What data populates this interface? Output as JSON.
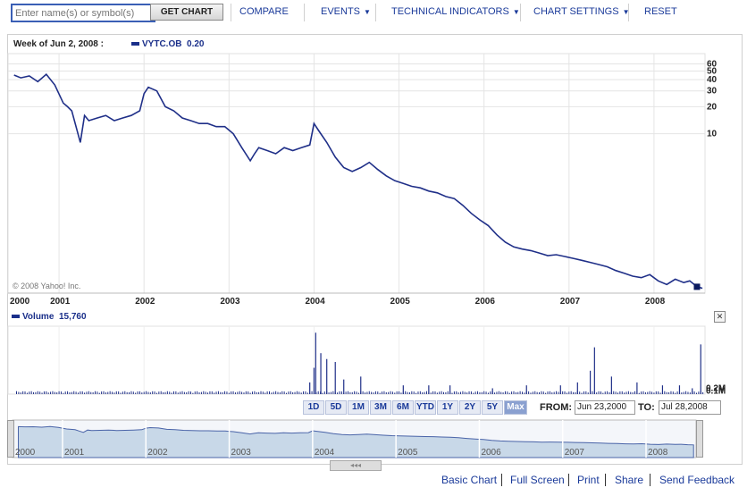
{
  "toolbar": {
    "symbol_placeholder": "Enter name(s) or symbol(s)",
    "get_chart": "GET CHART",
    "compare": "COMPARE",
    "events": "EVENTS",
    "technical_indicators": "TECHNICAL INDICATORS",
    "chart_settings": "CHART SETTINGS",
    "reset": "RESET"
  },
  "header": {
    "week_label": "Week of Jun 2, 2008 :",
    "ticker": "VYTC.OB",
    "ticker_value": "0.20"
  },
  "copyright": "© 2008 Yahoo! Inc.",
  "volume_header": {
    "label": "Volume",
    "value": "15,760"
  },
  "range_buttons": [
    "1D",
    "5D",
    "1M",
    "3M",
    "6M",
    "YTD",
    "1Y",
    "2Y",
    "5Y",
    "Max"
  ],
  "active_range": "Max",
  "from_label": "FROM:",
  "from_value": "Jun 23,2000",
  "to_label": "TO:",
  "to_value": "Jul 28,2008",
  "footer": {
    "basic_chart": "Basic Chart",
    "full_screen": "Full Screen",
    "print": "Print",
    "share": "Share",
    "send_feedback": "Send Feedback"
  },
  "colors": {
    "line": "#1f2f88",
    "accent": "#1a3a9a",
    "overview_fill": "#c8d8e8"
  },
  "chart_data": [
    {
      "type": "line",
      "scale": "log",
      "series": [
        {
          "name": "VYTC.OB",
          "x": [
            2000.47,
            2000.55,
            2000.65,
            2000.75,
            2000.85,
            2000.95,
            2001.05,
            2001.1,
            2001.15,
            2001.2,
            2001.25,
            2001.3,
            2001.35,
            2001.45,
            2001.55,
            2001.65,
            2001.75,
            2001.85,
            2001.95,
            2002.0,
            2002.05,
            2002.15,
            2002.25,
            2002.35,
            2002.45,
            2002.55,
            2002.65,
            2002.75,
            2002.85,
            2002.95,
            2003.05,
            2003.15,
            2003.25,
            2003.3,
            2003.35,
            2003.45,
            2003.55,
            2003.65,
            2003.75,
            2003.85,
            2003.95,
            2004.0,
            2004.05,
            2004.15,
            2004.25,
            2004.35,
            2004.45,
            2004.55,
            2004.65,
            2004.75,
            2004.85,
            2004.95,
            2005.05,
            2005.15,
            2005.25,
            2005.35,
            2005.45,
            2005.55,
            2005.65,
            2005.75,
            2005.85,
            2005.95,
            2006.05,
            2006.15,
            2006.25,
            2006.35,
            2006.45,
            2006.55,
            2006.65,
            2006.75,
            2006.85,
            2006.95,
            2007.05,
            2007.15,
            2007.25,
            2007.35,
            2007.45,
            2007.55,
            2007.65,
            2007.75,
            2007.85,
            2007.95,
            2008.05,
            2008.15,
            2008.25,
            2008.35,
            2008.42,
            2008.5,
            2008.57
          ],
          "y": [
            45,
            42,
            44,
            38,
            46,
            35,
            22,
            20,
            18,
            12,
            8,
            16,
            14,
            15,
            16,
            14,
            15,
            16,
            18,
            28,
            33,
            30,
            20,
            18,
            15,
            14,
            13,
            13,
            12,
            12,
            10,
            7,
            5,
            6,
            7,
            6.5,
            6,
            7,
            6.5,
            7,
            7.5,
            13,
            11,
            8,
            5.5,
            4.2,
            3.8,
            4.2,
            4.8,
            4.0,
            3.4,
            3.0,
            2.8,
            2.6,
            2.5,
            2.3,
            2.2,
            2.0,
            1.9,
            1.6,
            1.3,
            1.1,
            0.95,
            0.75,
            0.62,
            0.55,
            0.52,
            0.5,
            0.47,
            0.44,
            0.45,
            0.43,
            0.41,
            0.39,
            0.37,
            0.35,
            0.33,
            0.3,
            0.28,
            0.26,
            0.25,
            0.27,
            0.23,
            0.21,
            0.24,
            0.22,
            0.23,
            0.2,
            0.19
          ]
        }
      ],
      "x_ticks": [
        "2000",
        "2001",
        "2002",
        "2003",
        "2004",
        "2005",
        "2006",
        "2007",
        "2008"
      ],
      "y_ticks": [
        "60",
        "50",
        "40",
        "30",
        "20",
        "10"
      ],
      "xlim": [
        2000.4,
        2008.6
      ],
      "ylim": [
        0.18,
        65
      ],
      "grid": true
    },
    {
      "type": "bar",
      "series": [
        {
          "name": "Volume",
          "x": [
            2003.95,
            2004.0,
            2004.02,
            2004.08,
            2004.15,
            2004.25,
            2004.35,
            2004.55,
            2005.05,
            2005.35,
            2005.6,
            2006.1,
            2006.5,
            2006.9,
            2007.1,
            2007.25,
            2007.3,
            2007.5,
            2007.8,
            2008.1,
            2008.3,
            2008.45,
            2008.55
          ],
          "values": [
            0.04,
            0.09,
            0.21,
            0.14,
            0.12,
            0.11,
            0.05,
            0.06,
            0.03,
            0.03,
            0.03,
            0.02,
            0.03,
            0.03,
            0.04,
            0.08,
            0.16,
            0.06,
            0.04,
            0.03,
            0.03,
            0.02,
            0.17
          ]
        }
      ],
      "y_ticks": [
        "0.2M",
        "0.1M"
      ],
      "xlim": [
        2000.4,
        2008.6
      ],
      "ylim": [
        0,
        0.22
      ]
    }
  ],
  "overview_years": [
    "2000",
    "2001",
    "2002",
    "2003",
    "2004",
    "2005",
    "2006",
    "2007",
    "2008"
  ]
}
